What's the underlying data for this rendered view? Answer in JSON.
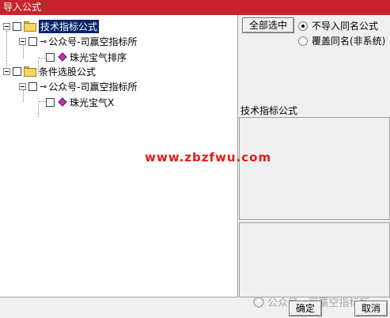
{
  "window": {
    "title": "导入公式"
  },
  "tree": {
    "groups": [
      {
        "label": "技术指标公式",
        "author": "公众号-司赢空指标所",
        "formula": "珠光宝气排序"
      },
      {
        "label": "条件选股公式",
        "author": "公众号-司赢空指标所",
        "formula": "珠光宝气X"
      }
    ]
  },
  "options": {
    "select_all_label": "全部选中",
    "radio_no_import_label": "不导入同名公式",
    "radio_overwrite_label": "覆盖同名(非系统)",
    "selected": "不导入同名公式"
  },
  "info": {
    "label": "技术指标公式"
  },
  "buttons": {
    "ok": "确定",
    "cancel": "取消"
  },
  "watermark": {
    "url": "www.zbzfwu.com",
    "bottom": "公众号 · 司赢空指标所"
  },
  "colors": {
    "titlebar": "#c8232b",
    "selection": "#0a246a",
    "watermark": "#e81818"
  }
}
